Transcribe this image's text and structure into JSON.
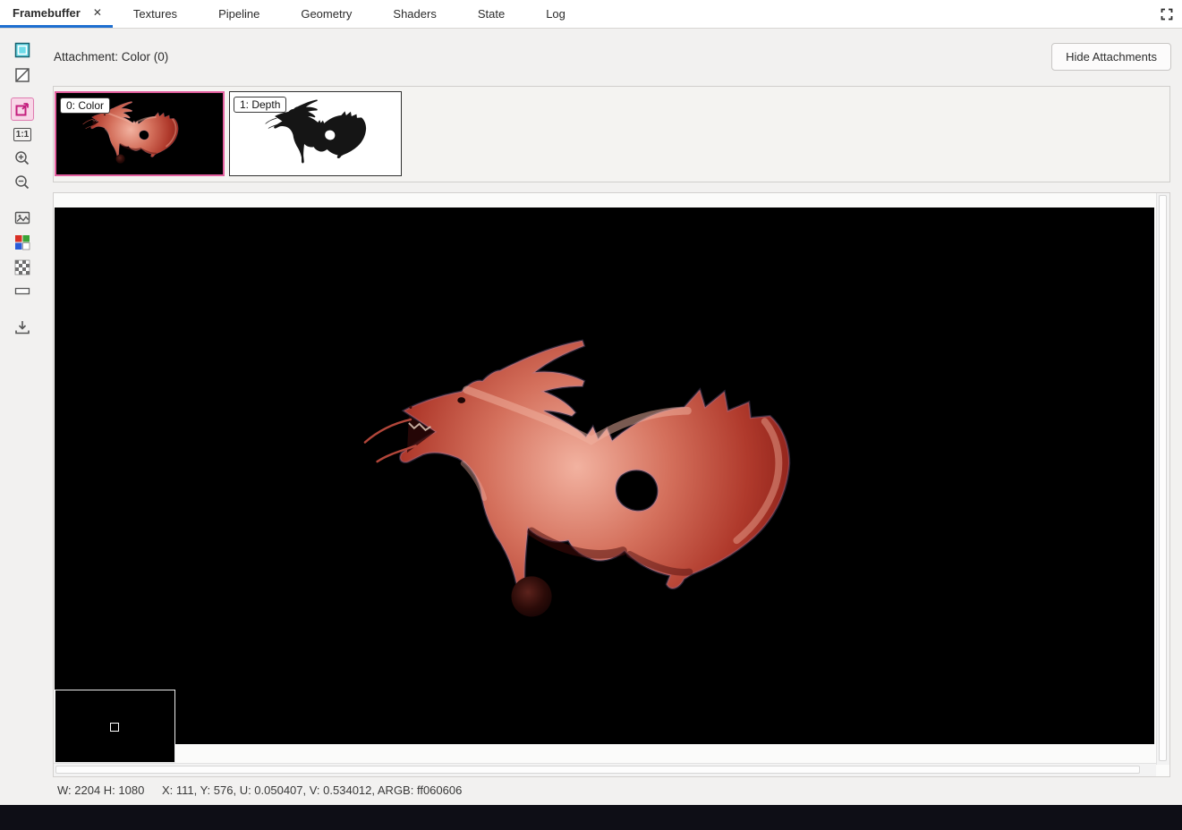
{
  "tabs": {
    "items": [
      {
        "label": "Framebuffer",
        "active": true
      },
      {
        "label": "Textures",
        "active": false
      },
      {
        "label": "Pipeline",
        "active": false
      },
      {
        "label": "Geometry",
        "active": false
      },
      {
        "label": "Shaders",
        "active": false
      },
      {
        "label": "State",
        "active": false
      },
      {
        "label": "Log",
        "active": false
      }
    ],
    "close_glyph": "✕"
  },
  "toolbar": {
    "icons": [
      "display-texture",
      "alpha-blend",
      "fit-window",
      "zoom-actual",
      "zoom-in",
      "zoom-out",
      "image-fit",
      "color-channels",
      "checkerboard-background",
      "range-control",
      "save-image"
    ],
    "zoom_actual_label": "1:1"
  },
  "attachments": {
    "header_label": "Attachment: Color (0)",
    "hide_button_label": "Hide Attachments",
    "items": [
      {
        "label": "0: Color",
        "selected": true
      },
      {
        "label": "1: Depth",
        "selected": false
      }
    ]
  },
  "viewport": {
    "model": "dragon",
    "texture_width": 2204,
    "texture_height": 1080
  },
  "status_bar": {
    "dimensions": "W: 2204 H: 1080",
    "pixel_info": "X: 111, Y: 576, U: 0.050407, V: 0.534012, ARGB: ff060606"
  },
  "colors": {
    "accent_blue": "#1e6fd0",
    "selection_pink": "#e35f9f",
    "render_background": "#000000",
    "dragon_base": "#b03a2c",
    "bottom_bar": "#0e0e16"
  }
}
